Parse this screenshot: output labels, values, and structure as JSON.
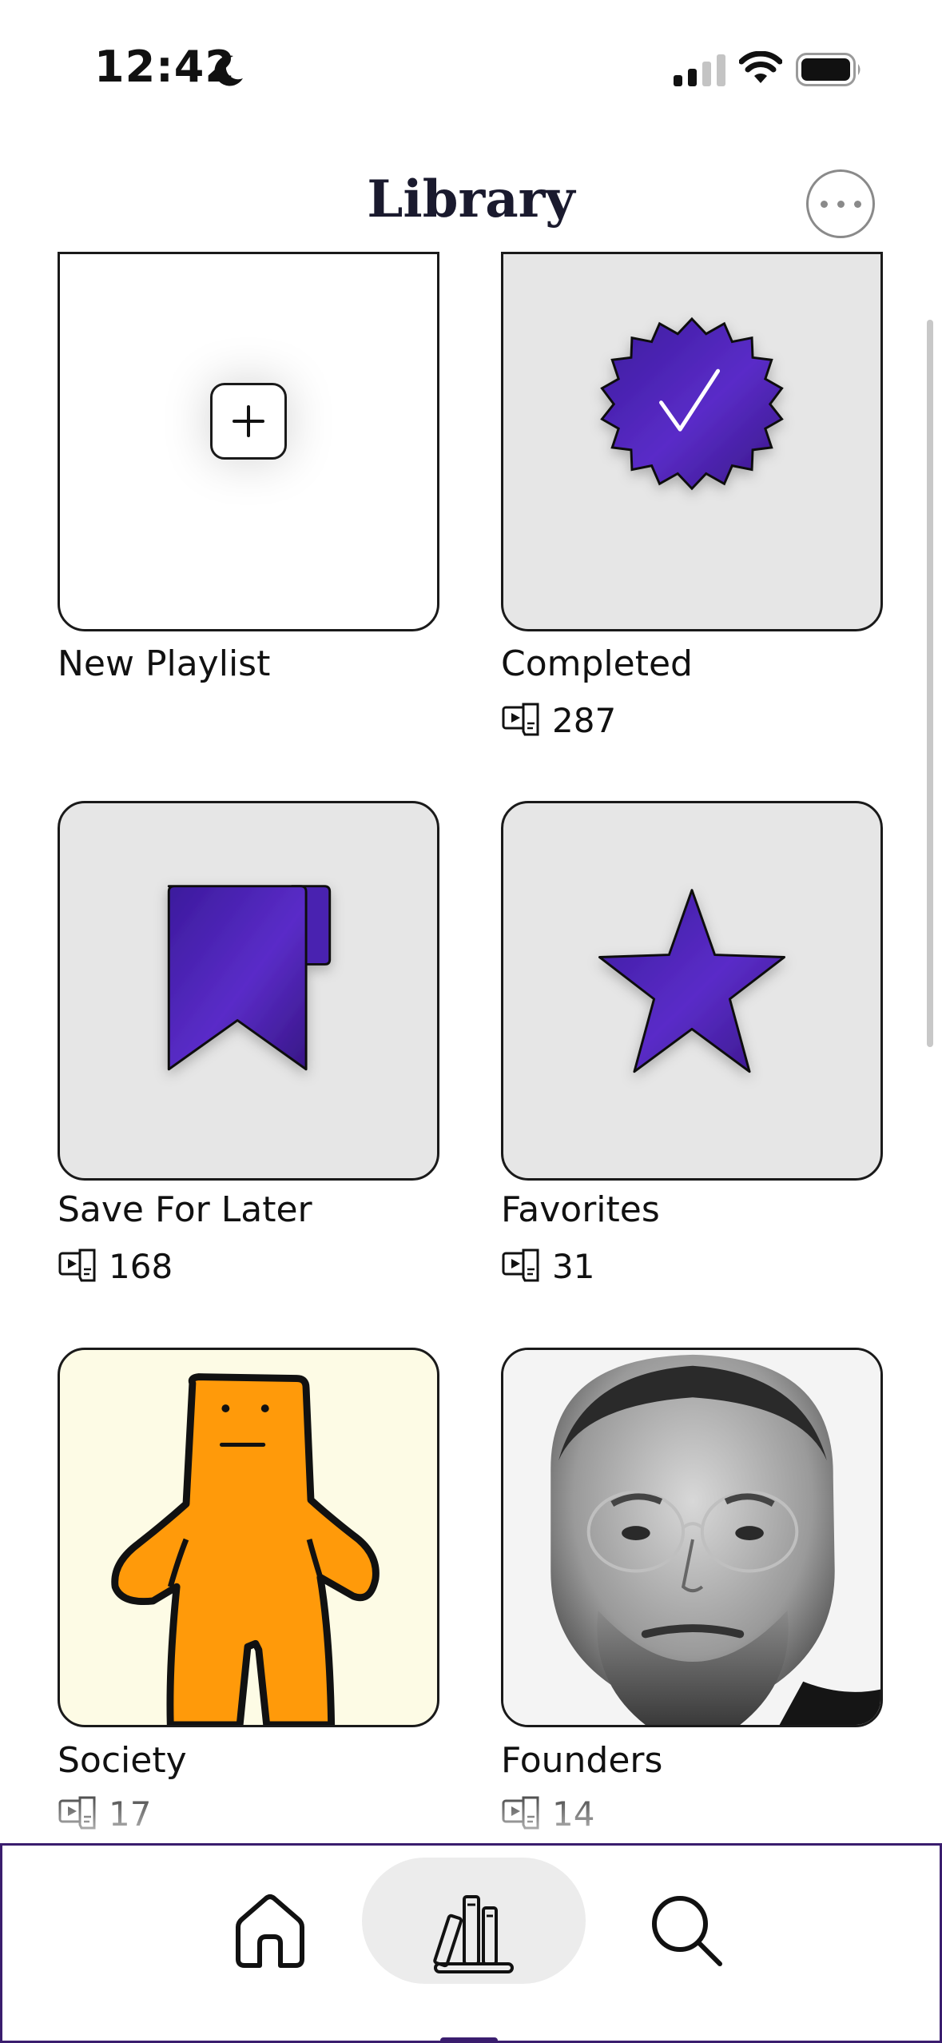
{
  "status_bar": {
    "time": "12:42",
    "icons": [
      "moon-icon",
      "cellular-signal-icon",
      "wifi-icon",
      "battery-icon"
    ]
  },
  "header": {
    "title": "Library",
    "more_icon": "ellipsis-icon"
  },
  "accent_color": "#4b22b0",
  "playlists": [
    {
      "label": "New Playlist",
      "count": null,
      "art": "plus-icon"
    },
    {
      "label": "Completed",
      "count": "287",
      "art": "check-badge-icon"
    },
    {
      "label": "Save For Later",
      "count": "168",
      "art": "bookmark-icon"
    },
    {
      "label": "Favorites",
      "count": "31",
      "art": "star-icon"
    },
    {
      "label": "Society",
      "count": "17",
      "art": "orange-figure-illustration"
    },
    {
      "label": "Founders",
      "count": "14",
      "art": "portrait-photo"
    }
  ],
  "tab_bar": {
    "items": [
      {
        "name": "home",
        "icon": "home-icon",
        "selected": false
      },
      {
        "name": "library",
        "icon": "library-icon",
        "selected": true
      },
      {
        "name": "search",
        "icon": "search-icon",
        "selected": false
      }
    ]
  }
}
